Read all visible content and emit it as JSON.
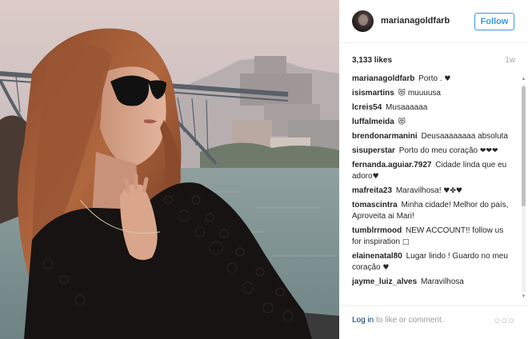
{
  "header": {
    "username": "marianagoldfarb",
    "follow_label": "Follow"
  },
  "post": {
    "likes": "3,133 likes",
    "age": "1w"
  },
  "comments": [
    {
      "user": "marianagoldfarb",
      "text": "Porto . ",
      "emoji": "♥"
    },
    {
      "user": "isismartins",
      "text": "muuuusa",
      "emoji_before": "😻"
    },
    {
      "user": "lcreis54",
      "text": "Musaaaaaa"
    },
    {
      "user": "luffalmeida",
      "text": "",
      "emoji": "😻"
    },
    {
      "user": "brendonarmanini",
      "text": "Deusaaaaaaaa absoluta"
    },
    {
      "user": "sisuperstar",
      "text": "Porto do meu coração ",
      "emoji": "❤❤❤"
    },
    {
      "user": "fernanda.aguiar.7927",
      "text": "Cidade linda que eu adoro",
      "emoji": "♥"
    },
    {
      "user": "mafreita23",
      "text": "Maravilhosa! ",
      "emoji": "♥✤♥"
    },
    {
      "user": "tomascintra",
      "text": "Minha cidade! Melhor do país, Aproveita ai Mari!"
    },
    {
      "user": "tumblrrmood",
      "text": "NEW ACCOUNT!! follow us for inspiration ",
      "emoji": "□"
    },
    {
      "user": "elainenatal80",
      "text": "Lugar lindo ! Guardo no meu coração ",
      "emoji": "♥"
    },
    {
      "user": "jayme_luiz_alves",
      "text": "Maravilhosa"
    }
  ],
  "footer": {
    "login_link": "Log in",
    "login_rest": " to like or comment.",
    "more_glyph": "○○○"
  },
  "icons": {
    "more": "more-options-icon",
    "avatar": "profile-avatar"
  },
  "colors": {
    "accent": "#3897f0",
    "link_dark": "#003569",
    "muted": "#a5a5a5"
  }
}
